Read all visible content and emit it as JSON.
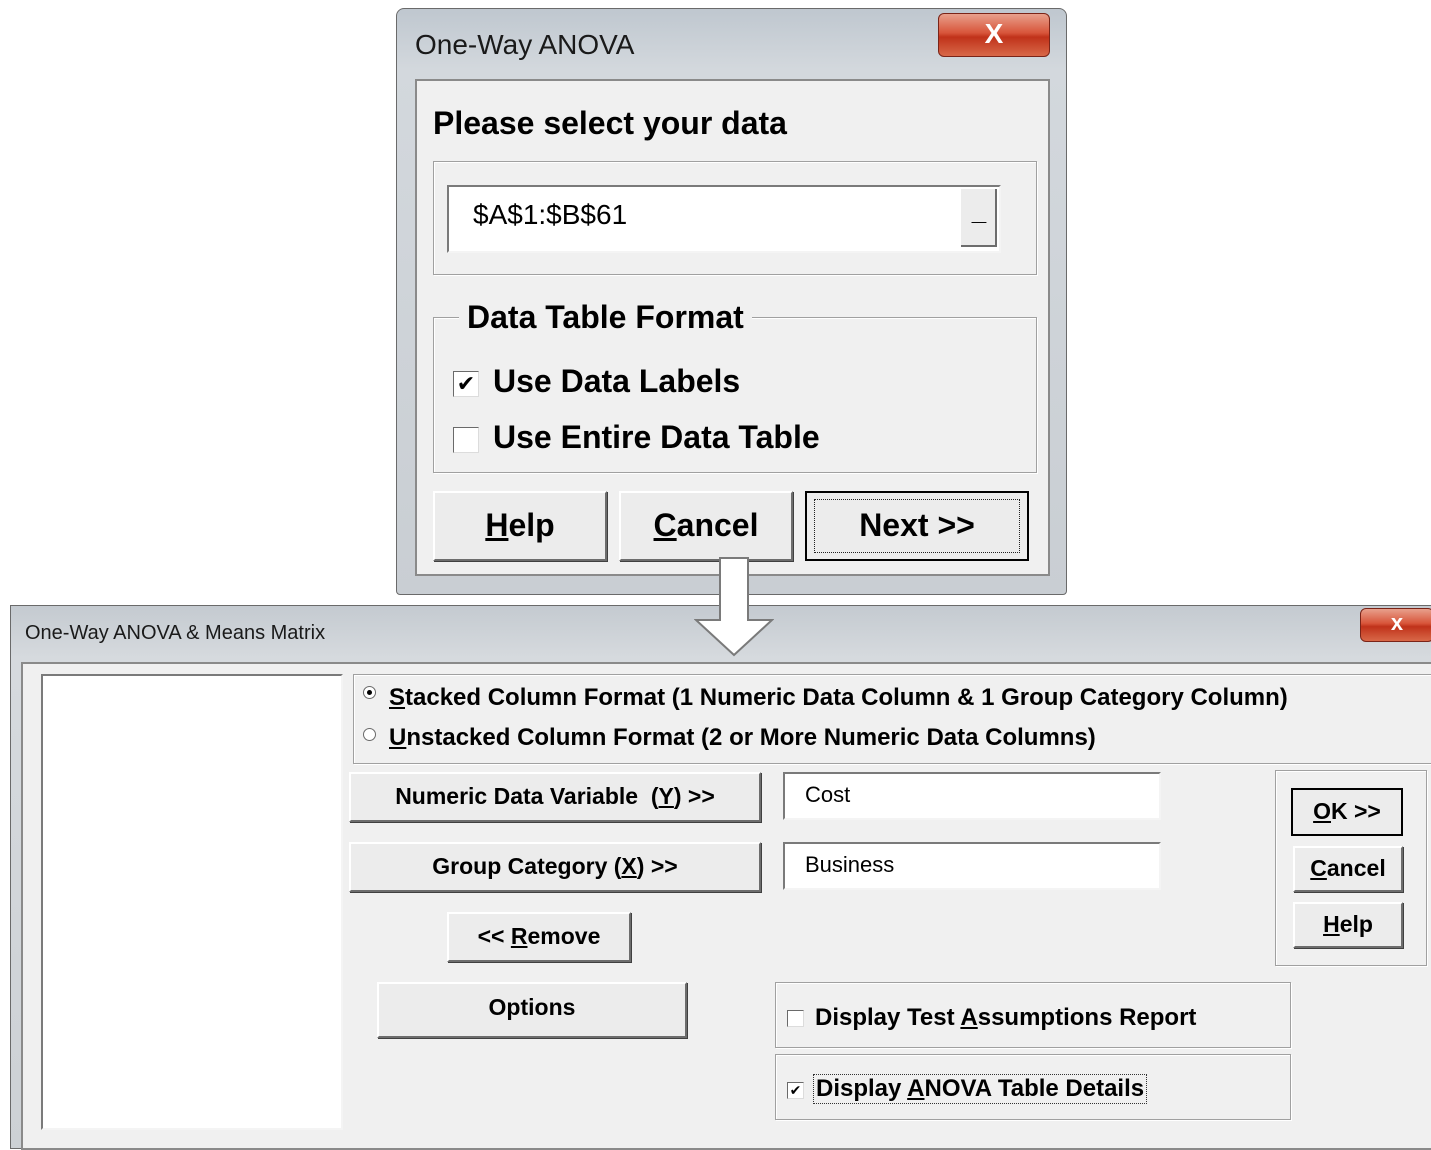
{
  "dialog1": {
    "title": "One-Way ANOVA",
    "close_glyph": "X",
    "heading": "Please select your data",
    "range_value": "$A$1:$B$61",
    "range_button_glyph": "_",
    "group_title": "Data Table Format",
    "use_data_labels": {
      "label": "Use Data Labels",
      "checked": true
    },
    "use_entire_table": {
      "label": "Use Entire Data Table",
      "checked": false
    },
    "help": {
      "mnemonic": "H",
      "rest": "elp"
    },
    "cancel": {
      "mnemonic": "C",
      "rest": "ancel"
    },
    "next_label": "Next >>"
  },
  "dialog2": {
    "title": "One-Way ANOVA & Means Matrix",
    "close_glyph": "x",
    "stacked": {
      "mnemonic": "S",
      "rest": "tacked Column Format (1 Numeric Data Column & 1 Group Category Column)",
      "selected": true
    },
    "unstacked": {
      "mnemonic": "U",
      "rest": "nstacked Column Format (2 or More Numeric Data Columns)",
      "selected": false
    },
    "numeric_btn": {
      "pre": "Numeric Data Variable  (",
      "mnemonic": "Y",
      "post": ") >>"
    },
    "numeric_value": "Cost",
    "group_btn": {
      "pre": "Group Category (",
      "mnemonic": "X",
      "post": ") >>"
    },
    "group_value": "Business",
    "remove_btn": {
      "pre": "<< ",
      "mnemonic": "R",
      "post": "emove"
    },
    "options_label": "Options",
    "ok": {
      "mnemonic": "O",
      "rest": "K >>"
    },
    "cancel": {
      "mnemonic": "C",
      "rest": "ancel"
    },
    "help": {
      "mnemonic": "H",
      "rest": "elp"
    },
    "assumptions": {
      "pre": "Display Test ",
      "mnemonic": "A",
      "post": "ssumptions Report",
      "checked": false
    },
    "anova_details": {
      "pre": "Display ",
      "mnemonic": "A",
      "post": "NOVA Table Details",
      "checked": true
    }
  },
  "check_glyph": "✔"
}
